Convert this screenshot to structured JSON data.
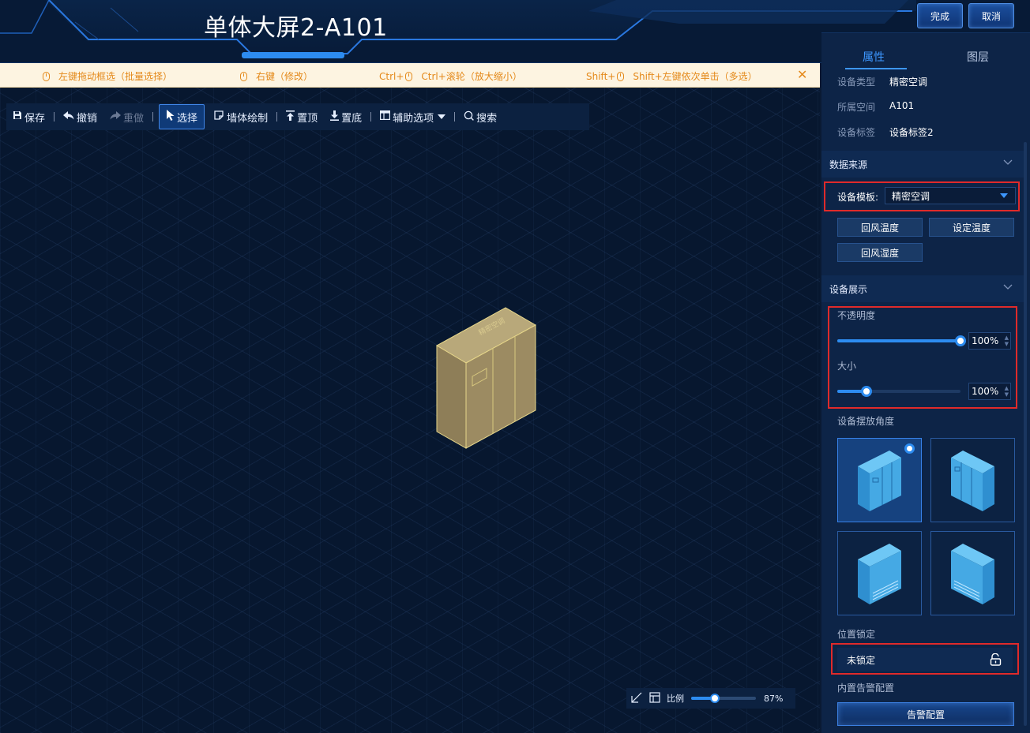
{
  "header": {
    "title": "单体大屏2-A101",
    "done_label": "完成",
    "cancel_label": "取消"
  },
  "tips": {
    "tip1": "左键拖动框选（批量选择）",
    "tip2": "右键（修改）",
    "tip3_prefix": "Ctrl+",
    "tip3": "Ctrl+滚轮（放大缩小）",
    "tip4_prefix": "Shift+",
    "tip4": "Shift+左键依次单击（多选）",
    "close": "✕"
  },
  "toolbar": {
    "save": "保存",
    "undo": "撤销",
    "redo": "重做",
    "select": "选择",
    "wall_draw": "墙体绘制",
    "top": "置顶",
    "bottom": "置底",
    "assist": "辅助选项",
    "search": "搜索"
  },
  "device": {
    "label": "精密空调"
  },
  "zoom": {
    "label": "比例",
    "value": "87%",
    "percent": 87
  },
  "panel": {
    "tabs": [
      "属性",
      "图层"
    ],
    "props": [
      {
        "key": "设备类型",
        "value": "精密空调"
      },
      {
        "key": "所属空间",
        "value": "A101"
      },
      {
        "key": "设备标签",
        "value": "设备标签2"
      }
    ],
    "data_source": {
      "title": "数据来源",
      "template_label": "设备模板:",
      "template_value": "精密空调",
      "fields": [
        "回风温度",
        "设定温度",
        "回风湿度"
      ]
    },
    "display": {
      "title": "设备展示",
      "opacity_label": "不透明度",
      "opacity_value": "100%",
      "opacity_percent": 100,
      "size_label": "大小",
      "size_value": "100%",
      "size_percent": 24,
      "angle_label": "设备摆放角度",
      "lock_label": "位置锁定",
      "lock_value": "未锁定",
      "alarm_label": "内置告警配置",
      "alarm_button": "告警配置"
    }
  },
  "colors": {
    "accent": "#2d8cf0",
    "highlight_border": "#e02a2a",
    "tip_text": "#e4891a"
  }
}
